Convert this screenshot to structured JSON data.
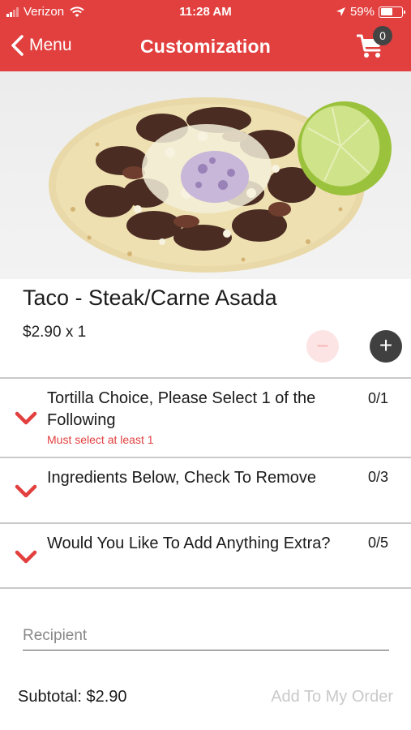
{
  "status_bar": {
    "carrier": "Verizon",
    "time": "11:28 AM",
    "battery_pct": "59%",
    "battery_level": 0.59,
    "icons": [
      "signal-icon",
      "wifi-icon",
      "location-arrow-icon",
      "battery-icon"
    ]
  },
  "nav": {
    "back_label": "Menu",
    "title": "Customization",
    "cart_count": "0",
    "icons": [
      "chevron-left-icon",
      "cart-icon"
    ]
  },
  "item": {
    "name": "Taco - Steak/Carne Asada",
    "price": "$2.90",
    "qty_text": "x 1",
    "minus_label": "−",
    "plus_label": "+"
  },
  "sections": [
    {
      "title": "Tortilla Choice, Please Select 1 of the Following",
      "count": "0/1",
      "error": "Must select at least 1"
    },
    {
      "title": "Ingredients Below, Check To Remove",
      "count": "0/3"
    },
    {
      "title": "Would You Like To Add Anything Extra?",
      "count": "0/5"
    }
  ],
  "recipient": {
    "placeholder": "Recipient",
    "value": ""
  },
  "footer": {
    "subtotal": "Subtotal: $2.90",
    "add_button": "Add To My Order"
  },
  "colors": {
    "brand_red": "#e2403f",
    "dark_button": "#404040",
    "disabled_text": "#c9c9c9"
  }
}
